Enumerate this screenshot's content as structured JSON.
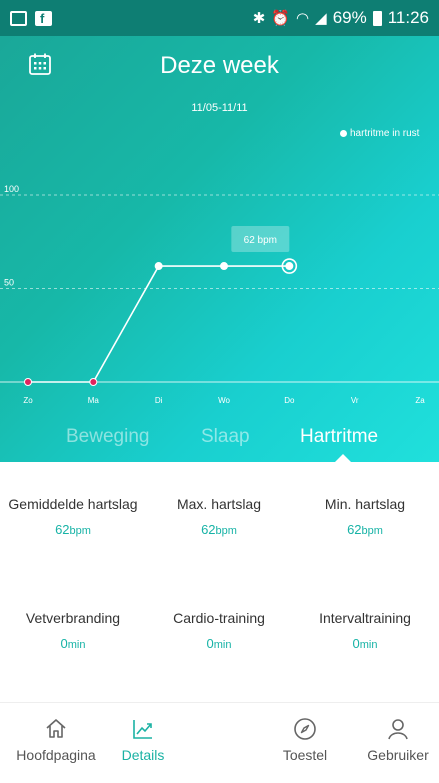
{
  "status_bar": {
    "battery": "69%",
    "time": "11:26"
  },
  "header": {
    "title": "Deze week"
  },
  "chart": {
    "date_range": "11/05-11/11",
    "tooltip": "62 bpm"
  },
  "chart_data": {
    "type": "line",
    "categories": [
      "Zo",
      "Ma",
      "Di",
      "Wo",
      "Do",
      "Vr",
      "Za"
    ],
    "series": [
      {
        "name": "hartritme in rust",
        "values": [
          0,
          0,
          62,
          62,
          62,
          null,
          null
        ]
      }
    ],
    "yticks": [
      "100",
      "50"
    ],
    "ylim": [
      0,
      100
    ],
    "grid": true,
    "legend": "top-right"
  },
  "tabs": [
    {
      "label": "Beweging"
    },
    {
      "label": "Slaap"
    },
    {
      "label": "Hartritme"
    }
  ],
  "stats": [
    {
      "label": "Gemiddelde hartslag",
      "value": "62",
      "unit": "bpm"
    },
    {
      "label": "Max. hartslag",
      "value": "62",
      "unit": "bpm"
    },
    {
      "label": "Min. hartslag",
      "value": "62",
      "unit": "bpm"
    },
    {
      "label": "Vetverbranding",
      "value": "0",
      "unit": "min"
    },
    {
      "label": "Cardio-training",
      "value": "0",
      "unit": "min"
    },
    {
      "label": "Intervaltraining",
      "value": "0",
      "unit": "min"
    }
  ],
  "nav": [
    {
      "label": "Hoofdpagina",
      "icon": "home-icon"
    },
    {
      "label": "Details",
      "icon": "chart-icon"
    },
    {
      "label": "Toestel",
      "icon": "compass-icon"
    },
    {
      "label": "Gebruiker",
      "icon": "user-icon"
    }
  ],
  "colors": {
    "accent": "#1bb2a4",
    "gradient_start": "#1aa697",
    "gradient_end": "#20e0dc",
    "point_zero": "#e0245e"
  }
}
